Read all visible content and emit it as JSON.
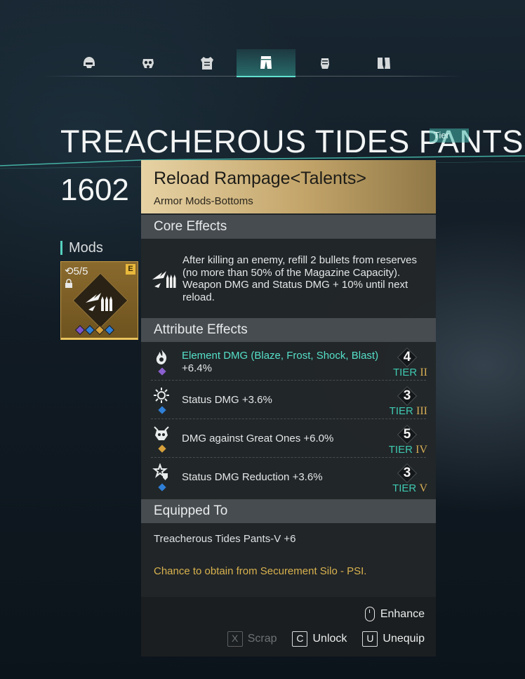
{
  "tabs": [
    {
      "id": "helmet",
      "icon": "helmet-icon",
      "active": false
    },
    {
      "id": "mask",
      "icon": "gas-mask-icon",
      "active": false
    },
    {
      "id": "top",
      "icon": "armor-vest-icon",
      "active": false
    },
    {
      "id": "bottoms",
      "icon": "pants-icon",
      "active": true
    },
    {
      "id": "gloves",
      "icon": "glove-icon",
      "active": false
    },
    {
      "id": "shoes",
      "icon": "boots-icon",
      "active": false
    }
  ],
  "item": {
    "name": "TREACHEROUS TIDES PANTS",
    "tier_tag": "Tier",
    "power": "1602"
  },
  "mods": {
    "label": "Mods",
    "count": "5/5",
    "grade": "E",
    "gems": [
      "#7b55c9",
      "#2f7fd6",
      "#d7a13c",
      "#2f7fd6"
    ]
  },
  "tooltip": {
    "title": "Reload Rampage<Talents>",
    "subtitle": "Armor Mods-Bottoms",
    "core": {
      "heading": "Core Effects",
      "text": "After killing an enemy, refill 2 bullets from reserves (no more than 50% of the Magazine Capacity). Weapon DMG and Status DMG + 10% until next reload."
    },
    "attributes": {
      "heading": "Attribute Effects",
      "rows": [
        {
          "icon": "flame-icon",
          "gem": "#8a5fcf",
          "name": "Element DMG (Blaze, Frost, Shock, Blast)",
          "value": "+6.4%",
          "tier_num": "4",
          "tier_word": "TIER",
          "tier_roman": "II"
        },
        {
          "icon": "status-burst-icon",
          "gem": "#2f7fd6",
          "name": "Status DMG",
          "value": "+3.6%",
          "tier_num": "3",
          "tier_word": "TIER",
          "tier_roman": "III"
        },
        {
          "icon": "great-one-skull-icon",
          "gem": "#d7a13c",
          "name": "DMG against Great Ones",
          "value": "+6.0%",
          "tier_num": "5",
          "tier_word": "TIER",
          "tier_roman": "IV"
        },
        {
          "icon": "status-shield-icon",
          "gem": "#2f7fd6",
          "name": "Status DMG Reduction",
          "value": "+3.6%",
          "tier_num": "3",
          "tier_word": "TIER",
          "tier_roman": "V"
        }
      ]
    },
    "equipped": {
      "heading": "Equipped To",
      "item": "Treacherous Tides Pants-V +6",
      "source": "Chance to obtain from Securement Silo - PSI."
    },
    "actions": {
      "enhance": "Enhance",
      "scrap": {
        "key": "X",
        "label": "Scrap"
      },
      "unlock": {
        "key": "C",
        "label": "Unlock"
      },
      "unequip": {
        "key": "U",
        "label": "Unequip"
      }
    }
  },
  "colors": {
    "accent_teal": "#55e0c9",
    "tier_gold": "#d6ac55",
    "header_gold": "#c3a56a",
    "source_gold": "#d9b24e"
  }
}
